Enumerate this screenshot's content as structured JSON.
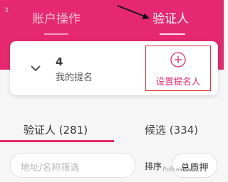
{
  "header": {
    "corner_number": "3",
    "tabs": [
      {
        "label": "账户操作",
        "active": false
      },
      {
        "label": "验证人",
        "active": true
      }
    ],
    "accent_color": "#e6286e"
  },
  "nomination_card": {
    "count": "4",
    "label": "我的提名",
    "set_button_label": "设置提名人"
  },
  "list_tabs": [
    {
      "label": "验证人 (281)",
      "active": true
    },
    {
      "label": "候选 (334)",
      "active": false
    }
  ],
  "filter": {
    "placeholder": "地址/名称筛选",
    "sort_label": "排序",
    "sort_value": "总质押"
  },
  "watermark": "PolkaWorld",
  "annotation_color": "#e8323c"
}
